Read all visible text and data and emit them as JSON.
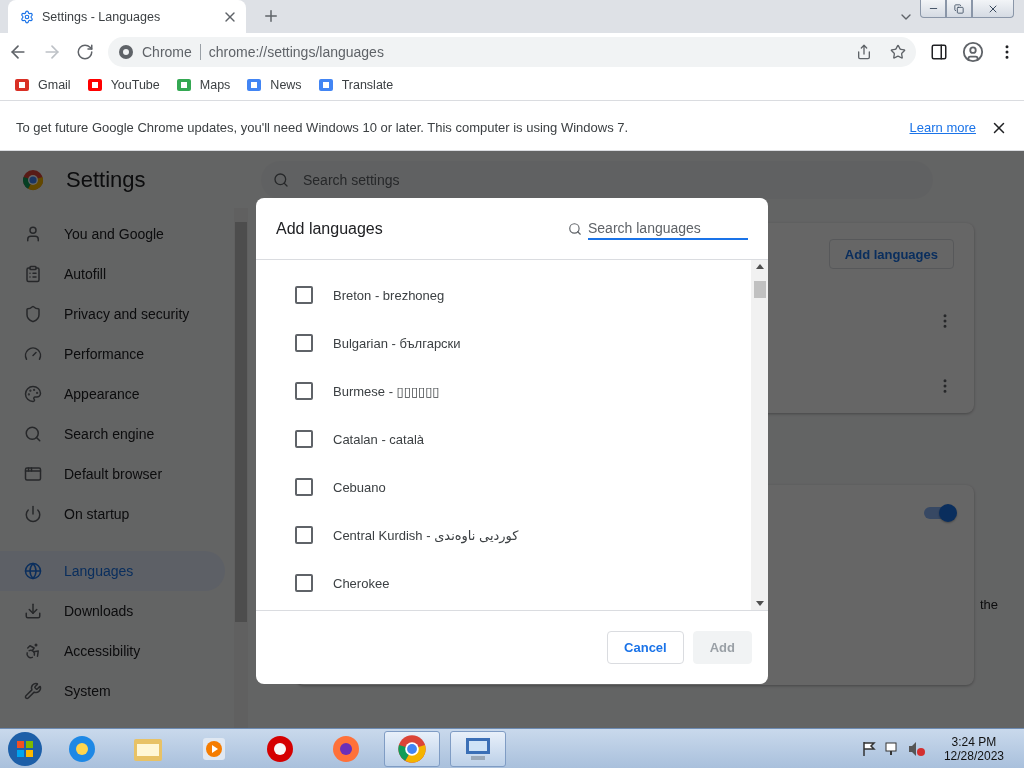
{
  "tab": {
    "title": "Settings - Languages"
  },
  "toolbar": {
    "site_label": "Chrome",
    "url": "chrome://settings/languages"
  },
  "bookmarks": [
    {
      "label": "Gmail"
    },
    {
      "label": "YouTube"
    },
    {
      "label": "Maps"
    },
    {
      "label": "News"
    },
    {
      "label": "Translate"
    }
  ],
  "infobar": {
    "message": "To get future Google Chrome updates, you'll need Windows 10 or later. This computer is using Windows 7.",
    "link": "Learn more"
  },
  "settings": {
    "title": "Settings",
    "search": {
      "placeholder": "Search settings"
    },
    "nav_groups": [
      {
        "items": [
          {
            "label": "You and Google",
            "selected": false
          },
          {
            "label": "Autofill",
            "selected": false
          },
          {
            "label": "Privacy and security",
            "selected": false
          },
          {
            "label": "Performance",
            "selected": false
          },
          {
            "label": "Appearance",
            "selected": false
          },
          {
            "label": "Search engine",
            "selected": false
          },
          {
            "label": "Default browser",
            "selected": false
          },
          {
            "label": "On startup",
            "selected": false
          }
        ]
      },
      {
        "items": [
          {
            "label": "Languages",
            "selected": true
          },
          {
            "label": "Downloads",
            "selected": false
          },
          {
            "label": "Accessibility",
            "selected": false
          },
          {
            "label": "System",
            "selected": false
          }
        ]
      }
    ],
    "add_languages_button": "Add languages",
    "spell_check": {
      "on": true,
      "text_fragment": "the"
    }
  },
  "dialog": {
    "title": "Add languages",
    "search": {
      "placeholder": "Search languages"
    },
    "languages": [
      {
        "label": "Breton - brezhoneg",
        "checked": false
      },
      {
        "label": "Bulgarian - български",
        "checked": false
      },
      {
        "label": "Burmese - ▯▯▯▯▯▯",
        "checked": false
      },
      {
        "label": "Catalan - català",
        "checked": false
      },
      {
        "label": "Cebuano",
        "checked": false
      },
      {
        "label": "Central Kurdish - کوردیی ناوەندی",
        "checked": false
      },
      {
        "label": "Cherokee",
        "checked": false
      }
    ],
    "buttons": [
      {
        "label": "Cancel",
        "disabled": false
      },
      {
        "label": "Add",
        "disabled": true
      }
    ]
  },
  "taskbar": {
    "time": "3:24 PM",
    "date": "12/28/2023"
  }
}
